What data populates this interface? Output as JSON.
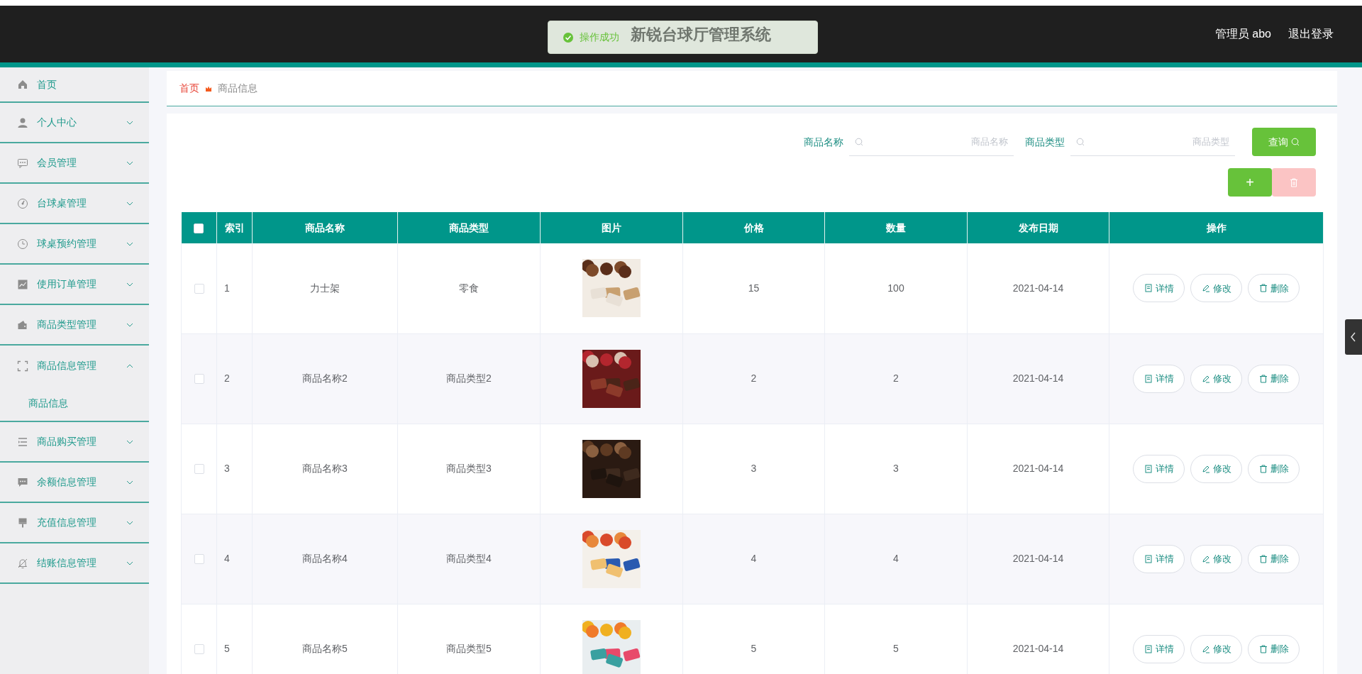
{
  "header": {
    "title": "新锐台球厅管理系统",
    "user": "管理员 abo",
    "logout": "退出登录"
  },
  "toast": {
    "text": "操作成功"
  },
  "sidebar": {
    "items": [
      {
        "label": "首页"
      },
      {
        "label": "个人中心",
        "expanded": false
      },
      {
        "label": "会员管理",
        "expanded": false
      },
      {
        "label": "台球桌管理",
        "expanded": false
      },
      {
        "label": "球桌预约管理",
        "expanded": false
      },
      {
        "label": "使用订单管理",
        "expanded": false
      },
      {
        "label": "商品类型管理",
        "expanded": false
      },
      {
        "label": "商品信息管理",
        "expanded": true,
        "children": [
          {
            "label": "商品信息"
          }
        ]
      },
      {
        "label": "商品购买管理",
        "expanded": false
      },
      {
        "label": "余额信息管理",
        "expanded": false
      },
      {
        "label": "充值信息管理",
        "expanded": false
      },
      {
        "label": "结账信息管理",
        "expanded": false
      }
    ]
  },
  "breadcrumb": [
    "首页",
    "商品信息"
  ],
  "search": {
    "fields": [
      {
        "label": "商品名称",
        "placeholder": "商品名称"
      },
      {
        "label": "商品类型",
        "placeholder": "商品类型"
      }
    ],
    "button": "查询"
  },
  "toolbar": [
    {
      "kind": "add",
      "text": "+",
      "disabled": false
    },
    {
      "kind": "delete",
      "disabled": true
    }
  ],
  "table": {
    "all_selected": false,
    "columns": [
      "索引",
      "商品名称",
      "商品类型",
      "图片",
      "价格",
      "数量",
      "发布日期",
      "操作"
    ],
    "rows": [
      {
        "selected": false,
        "index": "1",
        "name": "力士架",
        "type": "零食",
        "price": "15",
        "quantity": "100",
        "date": "2021-04-14",
        "actions": [
          "详情",
          "修改",
          "删除"
        ]
      },
      {
        "selected": false,
        "index": "2",
        "name": "商品名称2",
        "type": "商品类型2",
        "price": "2",
        "quantity": "2",
        "date": "2021-04-14",
        "actions": [
          "详情",
          "修改",
          "删除"
        ]
      },
      {
        "selected": false,
        "index": "3",
        "name": "商品名称3",
        "type": "商品类型3",
        "price": "3",
        "quantity": "3",
        "date": "2021-04-14",
        "actions": [
          "详情",
          "修改",
          "删除"
        ]
      },
      {
        "selected": false,
        "index": "4",
        "name": "商品名称4",
        "type": "商品类型4",
        "price": "4",
        "quantity": "4",
        "date": "2021-04-14",
        "actions": [
          "详情",
          "修改",
          "删除"
        ]
      },
      {
        "selected": false,
        "index": "5",
        "name": "商品名称5",
        "type": "商品类型5",
        "price": "5",
        "quantity": "5",
        "date": "2021-04-14",
        "actions": [
          "详情",
          "修改",
          "删除"
        ]
      }
    ]
  }
}
